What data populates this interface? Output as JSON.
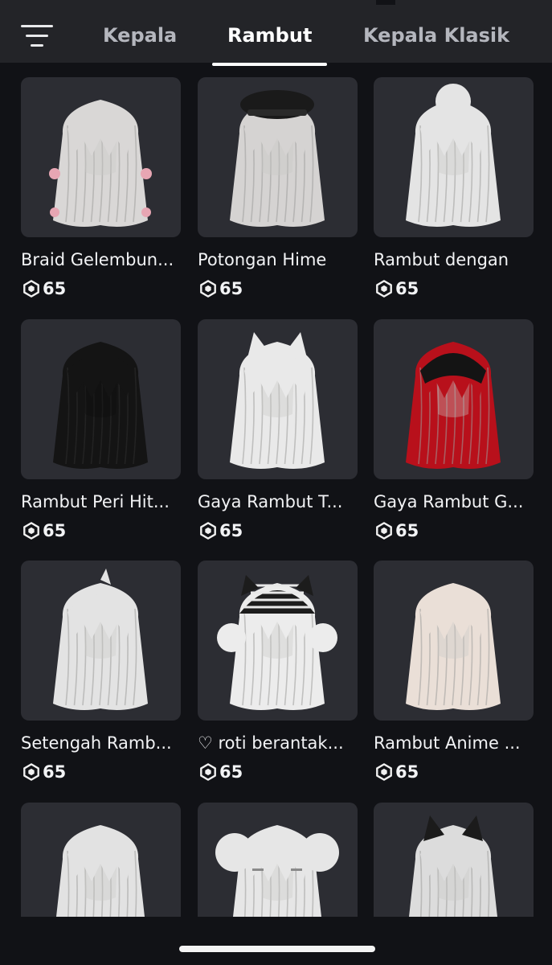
{
  "header": {
    "tabs": [
      {
        "label": "Kepala",
        "active": false
      },
      {
        "label": "Rambut",
        "active": true
      },
      {
        "label": "Kepala Klasik",
        "active": false
      }
    ]
  },
  "items": [
    {
      "name": "Braid Gelembun...",
      "price": "65",
      "hair_color": "#d9d7d6",
      "accent": "pink-ribbons"
    },
    {
      "name": "Potongan Hime",
      "price": "65",
      "hair_color": "#d5d3d2",
      "accent": "black-beret"
    },
    {
      "name": "Rambut dengan",
      "price": "65",
      "hair_color": "#e4e4e4",
      "accent": "messy-bun"
    },
    {
      "name": "Rambut Peri Hit...",
      "price": "65",
      "hair_color": "#141414",
      "accent": "none"
    },
    {
      "name": "Gaya Rambut T...",
      "price": "65",
      "hair_color": "#e9e9e9",
      "accent": "cat-ears"
    },
    {
      "name": "Gaya Rambut G...",
      "price": "65",
      "hair_color": "#b8101b",
      "accent": "black-roots"
    },
    {
      "name": "Setengah Ramb...",
      "price": "65",
      "hair_color": "#e3e3e3",
      "accent": "half-up"
    },
    {
      "name": "♡ roti berantak...",
      "price": "65",
      "hair_color": "#ececec",
      "accent": "striped-cat-beanie"
    },
    {
      "name": "Rambut Anime ...",
      "price": "65",
      "hair_color": "#eadfd7",
      "accent": "none"
    },
    {
      "name": "",
      "price": "",
      "hair_color": "#e2e2e2",
      "accent": "none"
    },
    {
      "name": "",
      "price": "",
      "hair_color": "#e6e6e6",
      "accent": "double-buns-clips"
    },
    {
      "name": "",
      "price": "",
      "hair_color": "#dcdcdc",
      "accent": "black-cat-ears"
    }
  ],
  "icons": {
    "filter": "filter-lines-icon",
    "currency": "robux-icon"
  }
}
